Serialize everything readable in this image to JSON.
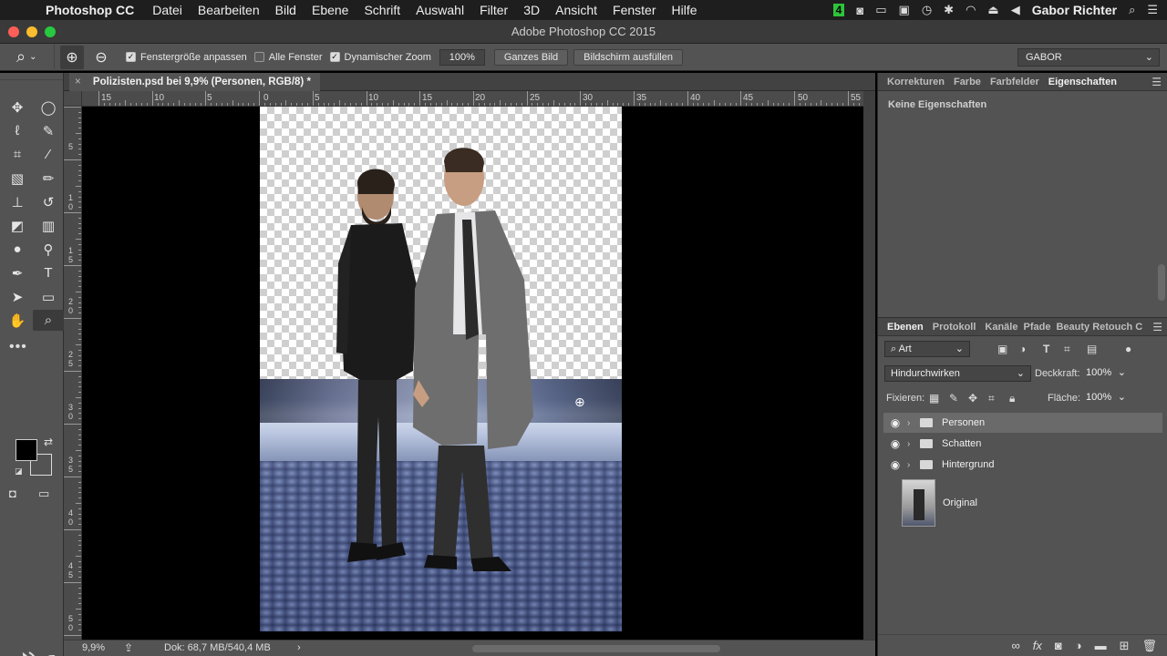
{
  "menubar": {
    "app": "Photoshop CC",
    "items": [
      "Datei",
      "Bearbeiten",
      "Bild",
      "Ebene",
      "Schrift",
      "Auswahl",
      "Filter",
      "3D",
      "Ansicht",
      "Fenster",
      "Hilfe"
    ],
    "status_icons": [
      "4",
      "camera-icon",
      "airplay-icon",
      "battery-icon",
      "time-machine-icon",
      "bluetooth-icon",
      "wifi-icon",
      "eject-icon",
      "volume-icon"
    ],
    "user": "Gabor Richter"
  },
  "window": {
    "title": "Adobe Photoshop CC 2015"
  },
  "options": {
    "fit_window": "Fenstergröße anpassen",
    "all_windows": "Alle Fenster",
    "scrubby_zoom": "Dynamischer Zoom",
    "zoom_value": "100%",
    "fit_screen": "Ganzes Bild",
    "fill_screen": "Bildschirm ausfüllen",
    "workspace": "GABOR"
  },
  "document": {
    "tab_title": "Polizisten.psd bei 9,9% (Personen, RGB/8) *"
  },
  "rulers": {
    "h_labels": [
      "15",
      "10",
      "5",
      "0",
      "5",
      "10",
      "15",
      "20",
      "25",
      "30",
      "35",
      "40",
      "45",
      "50",
      "55"
    ],
    "v_labels": [
      "5",
      "1\n0",
      "1\n5",
      "2\n0",
      "2\n5",
      "3\n0",
      "3\n5",
      "4\n0",
      "4\n5",
      "5\n0"
    ]
  },
  "status": {
    "zoom": "9,9%",
    "doc_size": "Dok: 68,7 MB/540,4 MB"
  },
  "panels": {
    "top_tabs": [
      "Korrekturen",
      "Farbe",
      "Farbfelder",
      "Eigenschaften"
    ],
    "properties_text": "Keine Eigenschaften",
    "layer_tabs": [
      "Ebenen",
      "Protokoll",
      "Kanäle",
      "Pfade",
      "Beauty Retouch C"
    ],
    "filter_kind": "Art",
    "blend_mode": "Hindurchwirken",
    "opacity_label": "Deckkraft:",
    "opacity_value": "100%",
    "lock_label": "Fixieren:",
    "fill_label": "Fläche:",
    "fill_value": "100%",
    "layers": [
      {
        "name": "Personen",
        "selected": true
      },
      {
        "name": "Schatten",
        "selected": false
      },
      {
        "name": "Hintergrund",
        "selected": false
      },
      {
        "name": "Original",
        "selected": false
      }
    ]
  }
}
